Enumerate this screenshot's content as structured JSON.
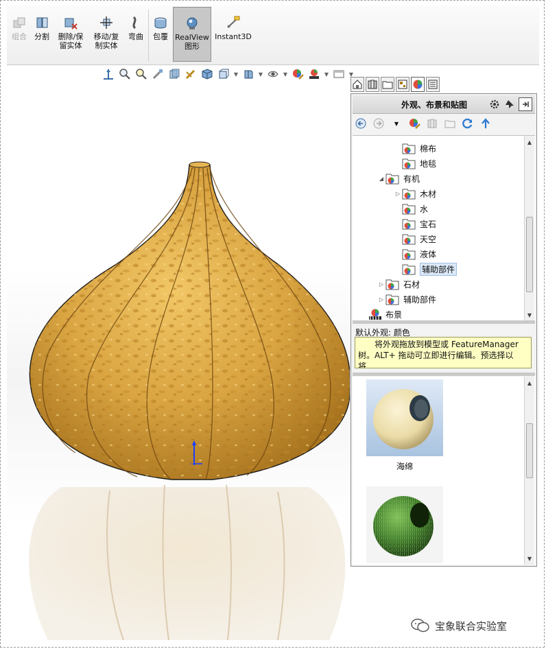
{
  "ribbon": {
    "buttons": [
      {
        "label": "组合",
        "state": "disabled"
      },
      {
        "label": "分割",
        "state": "normal"
      },
      {
        "label": "删除/保\n留实体",
        "state": "normal"
      },
      {
        "label": "移动/复\n制实体",
        "state": "normal"
      },
      {
        "label": "弯曲",
        "state": "normal"
      },
      {
        "label": "包覆",
        "state": "normal"
      },
      {
        "label": "RealView\n图形",
        "state": "active"
      },
      {
        "label": "Instant3D",
        "state": "normal"
      }
    ]
  },
  "heads_up_toolbar": {
    "icons": [
      "zoom-to-fit-icon",
      "zoom-area-icon",
      "previous-view-icon",
      "section-view-icon",
      "dynamic-annotation-icon",
      "view-orientation-icon",
      "display-style-icon",
      "hide-show-icon",
      "edit-appearance-icon",
      "apply-scene-icon",
      "view-settings-icon"
    ]
  },
  "task_pane": {
    "tabs": [
      "home-icon",
      "design-library-icon",
      "file-explorer-icon",
      "view-palette-icon",
      "appearances-icon",
      "custom-properties-icon"
    ],
    "active_tab": 4,
    "title": "外观、布景和贴图",
    "tree": [
      {
        "label": "棉布",
        "level": 2,
        "expander": "none",
        "selected": false
      },
      {
        "label": "地毯",
        "level": 2,
        "expander": "none",
        "selected": false
      },
      {
        "label": "有机",
        "level": 1,
        "expander": "expanded",
        "selected": false
      },
      {
        "label": "木材",
        "level": 2,
        "expander": "collapsed",
        "selected": false
      },
      {
        "label": "水",
        "level": 2,
        "expander": "none",
        "selected": false
      },
      {
        "label": "宝石",
        "level": 2,
        "expander": "none",
        "selected": false
      },
      {
        "label": "天空",
        "level": 2,
        "expander": "none",
        "selected": false
      },
      {
        "label": "液体",
        "level": 2,
        "expander": "none",
        "selected": false
      },
      {
        "label": "辅助部件",
        "level": 2,
        "expander": "none",
        "selected": true
      },
      {
        "label": "石材",
        "level": 1,
        "expander": "collapsed",
        "selected": false
      },
      {
        "label": "辅助部件",
        "level": 1,
        "expander": "collapsed",
        "selected": false
      },
      {
        "label": "布景",
        "level": 0,
        "expander": "none",
        "selected": false
      }
    ],
    "description_title": "默认外观: 颜色",
    "description": "将外观拖放到模型或 FeatureManager 树。ALT+ 拖动可立即进行编辑。预选择以将...",
    "swatches": [
      {
        "label": "海绵",
        "color": "#efe2b4"
      },
      {
        "label": "",
        "color": "#3d7a2a"
      }
    ]
  },
  "watermark": "宝象联合实验室"
}
